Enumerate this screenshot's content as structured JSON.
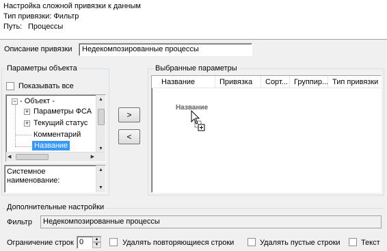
{
  "header": {
    "title": "Настройка сложной привязки к данным",
    "binding_type": "Тип привязки: Фильтр",
    "path_label": "Путь:",
    "path_value": "Процессы"
  },
  "binding_description": {
    "label": "Описание привязки",
    "value": "Недекомпозированные процессы"
  },
  "object_params": {
    "legend": "Параметры объекта",
    "show_all_label": "Показывать все",
    "tree": [
      {
        "label": "- Объект -",
        "expander": "−"
      },
      {
        "label": "Параметры ФСА",
        "expander": "+"
      },
      {
        "label": "Текущий статус",
        "expander": "+"
      },
      {
        "label": "Комментарий",
        "expander": ""
      },
      {
        "label": "Название",
        "expander": "",
        "selected": true
      }
    ],
    "description_text": "Системное наименование:"
  },
  "buttons": {
    "add": ">",
    "remove": "<"
  },
  "selected_params": {
    "legend": "Выбранные параметры",
    "columns": [
      "Название",
      "Привязка",
      "Сорт...",
      "Группир...",
      "Тип привязки"
    ],
    "drag_label": "Название"
  },
  "extra_settings": {
    "legend": "Дополнительные настройки",
    "filter_label": "Фильтр",
    "filter_value": "Недекомпозированные процессы",
    "row_limit_label": "Ограничение строк",
    "row_limit_value": "0",
    "remove_duplicates_label": "Удалять повторяющиеся строки",
    "remove_empty_label": "Удалять пустые строки",
    "text_label": "Текст"
  },
  "colors": {
    "selection": "#3399ff",
    "border": "#a0a0a0"
  }
}
